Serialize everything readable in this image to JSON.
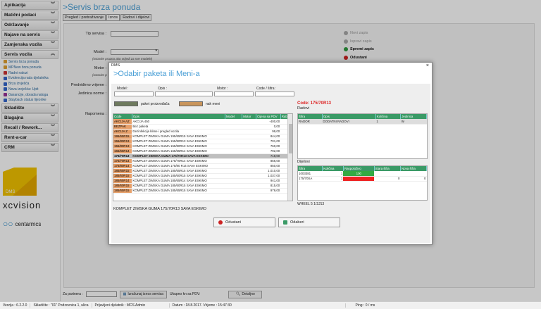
{
  "sidebar": {
    "sections": [
      {
        "label": "Aplikacija"
      },
      {
        "label": "Matični podaci"
      },
      {
        "label": "Održavanje"
      },
      {
        "label": "Najave na servis"
      },
      {
        "label": "Zamjenska vozila"
      },
      {
        "label": "Servis vozila"
      }
    ],
    "items": [
      {
        "label": "Servis brza ponuda",
        "color": "#e0a030"
      },
      {
        "label": "MPNew brza ponuda",
        "color": "#e0a030"
      },
      {
        "label": "Radni nalozi",
        "color": "#cc3333"
      },
      {
        "label": "Evidencija rada djelatnika",
        "color": "#3366cc"
      },
      {
        "label": "Brza izvješća",
        "color": "#3366cc"
      },
      {
        "label": "Nova izvješća: Upit",
        "color": "#3366cc"
      },
      {
        "label": "Garancije, obrada naloga",
        "color": "#993399"
      },
      {
        "label": "Stayback status lijeonke",
        "color": "#3366cc"
      }
    ],
    "sections2": [
      {
        "label": "Skladište"
      },
      {
        "label": "Blagajna"
      },
      {
        "label": "Recall / Rework..."
      },
      {
        "label": "Rent-a-car"
      },
      {
        "label": "CRM"
      }
    ],
    "logo_dms": "DMS",
    "logo_xc": "xcvision",
    "logo_centar": "centarmcs"
  },
  "main": {
    "title": ">Servis brza ponuda",
    "tabs": [
      "Pregled / pretraživanje",
      "Iznos",
      "Radovi i dijelovi"
    ],
    "labels": {
      "tip_servisa": "Tip servisa :",
      "model": "Model :",
      "model_hint": "(ostavite prazno ako vrijedi za sve modele)",
      "motor": "Motor :",
      "motor_hint": "(ostavite p",
      "predvideno": "Predviđeno vrijeme :",
      "jedinica": "Jedinica norme :",
      "napomena": "Napomena :"
    },
    "actions": [
      {
        "label": "Novi zapis",
        "enabled": false,
        "color": "#aaaaaa"
      },
      {
        "label": "Ispravi zapis",
        "enabled": false,
        "color": "#aaaaaa"
      },
      {
        "label": "Spremi zapis",
        "enabled": true,
        "color": "#2e9a3e"
      },
      {
        "label": "Odustani",
        "enabled": true,
        "color": "#cc2222"
      }
    ]
  },
  "bottom": {
    "partner_label": "Za partnera :",
    "calc_button": "Izračunaj iznos servisa",
    "ukupno": "Ukupno kn sa PDV:",
    "detaljno": "Detaljno"
  },
  "status": {
    "verzija": "Verzija : 6.2.2.0",
    "skladiste": "Skladište : \"01\" Podzovnica 1, ulica",
    "djelatnik": "Prijavljeni djelatnik : MCS Admin",
    "datum": "Datum : 18.8.2017. Vrijeme : 15:47:30",
    "ping": "Ping : 0 / ms"
  },
  "modal": {
    "window_title": "DMS",
    "close": "×",
    "heading": ">Odabir paketa ili Meni-a",
    "filters": {
      "model": "Model :",
      "opis": "Opis :",
      "motor": "Motor :",
      "code": "Code / šifra:"
    },
    "legend": [
      {
        "label": "paket proizvođača",
        "color": "#6e7a5e"
      },
      {
        "label": "nak meni",
        "color": "#c9955b"
      }
    ],
    "table_headers": [
      "Code",
      "Opis",
      "Model",
      "Motor",
      "Cijena sa PDV",
      "Rabat"
    ],
    "rows": [
      {
        "code": "AKCIJA AZ",
        "opis": "AKCIJA 450",
        "cijena": "-400,00",
        "rabat": ""
      },
      {
        "code": "BEZPAK",
        "opis": "Bez paketa",
        "cijena": "0,00",
        "rabat": "0"
      },
      {
        "code": "AKCIJA Z",
        "opis": "Dezinfekcija klime i pregled vozila",
        "cijena": "99,00",
        "rabat": ""
      },
      {
        "code": "195/65R15",
        "opis": "KOMPLET ZIMSKA GUMA 195/65R15 SAVA ESKIMO",
        "cijena": "844,00",
        "rabat": ""
      },
      {
        "code": "155/80R13",
        "opis": "KOMPLET ZIMSKA GUMA 155/80R13 SAVA ESKIMO",
        "cijena": "701,00",
        "rabat": ""
      },
      {
        "code": "155/80R13",
        "opis": "KOMPLET ZIMSKA GUMA 155/80R13 SAVA ESKIMO",
        "cijena": "760,00",
        "rabat": "10"
      },
      {
        "code": "165/65R14",
        "opis": "KOMPLET ZIMSKA GUMA 165/65R14 SAVA ESKIMO",
        "cijena": "792,00",
        "rabat": ""
      },
      {
        "code": "175/70R13",
        "opis": "KOMPLET ZIMSKA GUMA 175/70R13 SAVA ESKIMO",
        "cijena": "718,00",
        "rabat": "",
        "selected": true
      },
      {
        "code": "175/70R14",
        "opis": "KOMPLET ZIMSKA GUMA 175/70R14 SAVA ESKIMO",
        "cijena": "856,00",
        "rabat": ""
      },
      {
        "code": "175/80R14",
        "opis": "KOMPLET ZIMSKA GUMA 175/80 R14 SAVA ESKIMO",
        "cijena": "850,00",
        "rabat": ""
      },
      {
        "code": "185/65R15",
        "opis": "KOMPLET ZIMSKA GUMA 185/65R15 SAVA ESKIMO",
        "cijena": "1.010,00",
        "rabat": ""
      },
      {
        "code": "185/60R15",
        "opis": "KOMPLET ZIMSKA GUMA 185/60R15 SAVA ESKIMO",
        "cijena": "1.037,00",
        "rabat": ""
      },
      {
        "code": "185/65R14",
        "opis": "KOMPLET ZIMSKA GUMA 185/65R14 SAVA ESKIMO",
        "cijena": "941,00",
        "rabat": "10"
      },
      {
        "code": "185/60R15",
        "opis": "KOMPLET ZIMSKA GUMA 185/60R15 SAVA ESKIMO",
        "cijena": "815,00",
        "rabat": ""
      },
      {
        "code": "185/65R15",
        "opis": "KOMPLET ZIMSKA GUMA 185/65R15 SAVA ESKIMO",
        "cijena": "979,00",
        "rabat": ""
      }
    ],
    "code_label": "Code: 175/70R13",
    "radovi_label": "Radovi",
    "radovi_headers": [
      "Šifra",
      "Opis",
      "Količina",
      "Jedinica"
    ],
    "radovi_rows": [
      {
        "sifra": "RADOR",
        "opis": "DODATNI RADOVI",
        "kolicina": "1",
        "jedinica": "W"
      }
    ],
    "dijelovi_label": "Dijelovi",
    "dijelovi_headers": [
      "Šifra",
      "Količina",
      "Raspoloživo",
      "Stara šifra",
      "Nova šifra"
    ],
    "dijelovi_rows": [
      {
        "sifra": "1003381",
        "kolicina": "1",
        "rasp": "100",
        "stara": "",
        "nova": "",
        "color": "#33aa44"
      },
      {
        "sifra": "175/70SA",
        "kolicina": "1",
        "rasp": "",
        "stara": "0",
        "nova": "0",
        "color": "#ee2222"
      }
    ],
    "wheel_text": "WHEEL 5 1/2J13",
    "selected_text": "KOMPLET ZIMSKA GUMA 175/70R13 SAVA ESKIMO",
    "cancel": "Odustani",
    "select": "Odaberi"
  }
}
